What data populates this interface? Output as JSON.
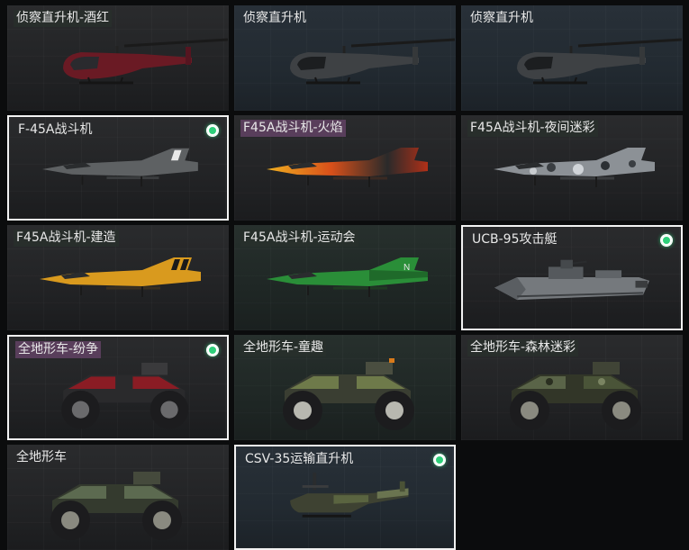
{
  "grid": {
    "cards": [
      {
        "id": "recon-heli-wine",
        "label": "侦察直升机-酒红",
        "vehicle": "helicopter",
        "accent": "#7a1f2a",
        "equipped": false,
        "selected": false
      },
      {
        "id": "recon-heli-2",
        "label": "侦察直升机",
        "vehicle": "helicopter",
        "accent": "#4a4c4e",
        "equipped": false,
        "selected": false
      },
      {
        "id": "recon-heli-3",
        "label": "侦察直升机",
        "vehicle": "helicopter",
        "accent": "#4a4c4e",
        "equipped": false,
        "selected": false
      },
      {
        "id": "f45a",
        "label": "F-45A战斗机",
        "vehicle": "jet",
        "accent": "#6b6e70",
        "equipped": true,
        "selected": true
      },
      {
        "id": "f45a-flame",
        "label": "F45A战斗机-火焰",
        "vehicle": "jet",
        "accent": "#d8501a",
        "equipped": false,
        "selected": false
      },
      {
        "id": "f45a-night-camo",
        "label": "F45A战斗机-夜间迷彩",
        "vehicle": "jet",
        "accent": "#9aa0a6",
        "equipped": false,
        "selected": false
      },
      {
        "id": "f45a-construction",
        "label": "F45A战斗机-建造",
        "vehicle": "jet",
        "accent": "#e0a020",
        "equipped": false,
        "selected": false
      },
      {
        "id": "f45a-sports",
        "label": "F45A战斗机-运动会",
        "vehicle": "jet",
        "accent": "#2a9a3a",
        "equipped": false,
        "selected": false
      },
      {
        "id": "ucb95",
        "label": "UCB-95攻击艇",
        "vehicle": "boat",
        "accent": "#8c9094",
        "equipped": true,
        "selected": true
      },
      {
        "id": "atv-conflict",
        "label": "全地形车-纷争",
        "vehicle": "atv",
        "accent": "#a01c22",
        "equipped": true,
        "selected": true
      },
      {
        "id": "atv-fun",
        "label": "全地形车-童趣",
        "vehicle": "atv",
        "accent": "#6e7a4a",
        "equipped": false,
        "selected": false
      },
      {
        "id": "atv-forest-camo",
        "label": "全地形车-森林迷彩",
        "vehicle": "atv",
        "accent": "#5a6448",
        "equipped": false,
        "selected": false
      },
      {
        "id": "atv",
        "label": "全地形车",
        "vehicle": "atv",
        "accent": "#5c6a50",
        "equipped": false,
        "selected": false
      },
      {
        "id": "csv35",
        "label": "CSV-35运输直升机",
        "vehicle": "tiltrotor",
        "accent": "#5a6440",
        "equipped": true,
        "selected": true
      }
    ]
  }
}
